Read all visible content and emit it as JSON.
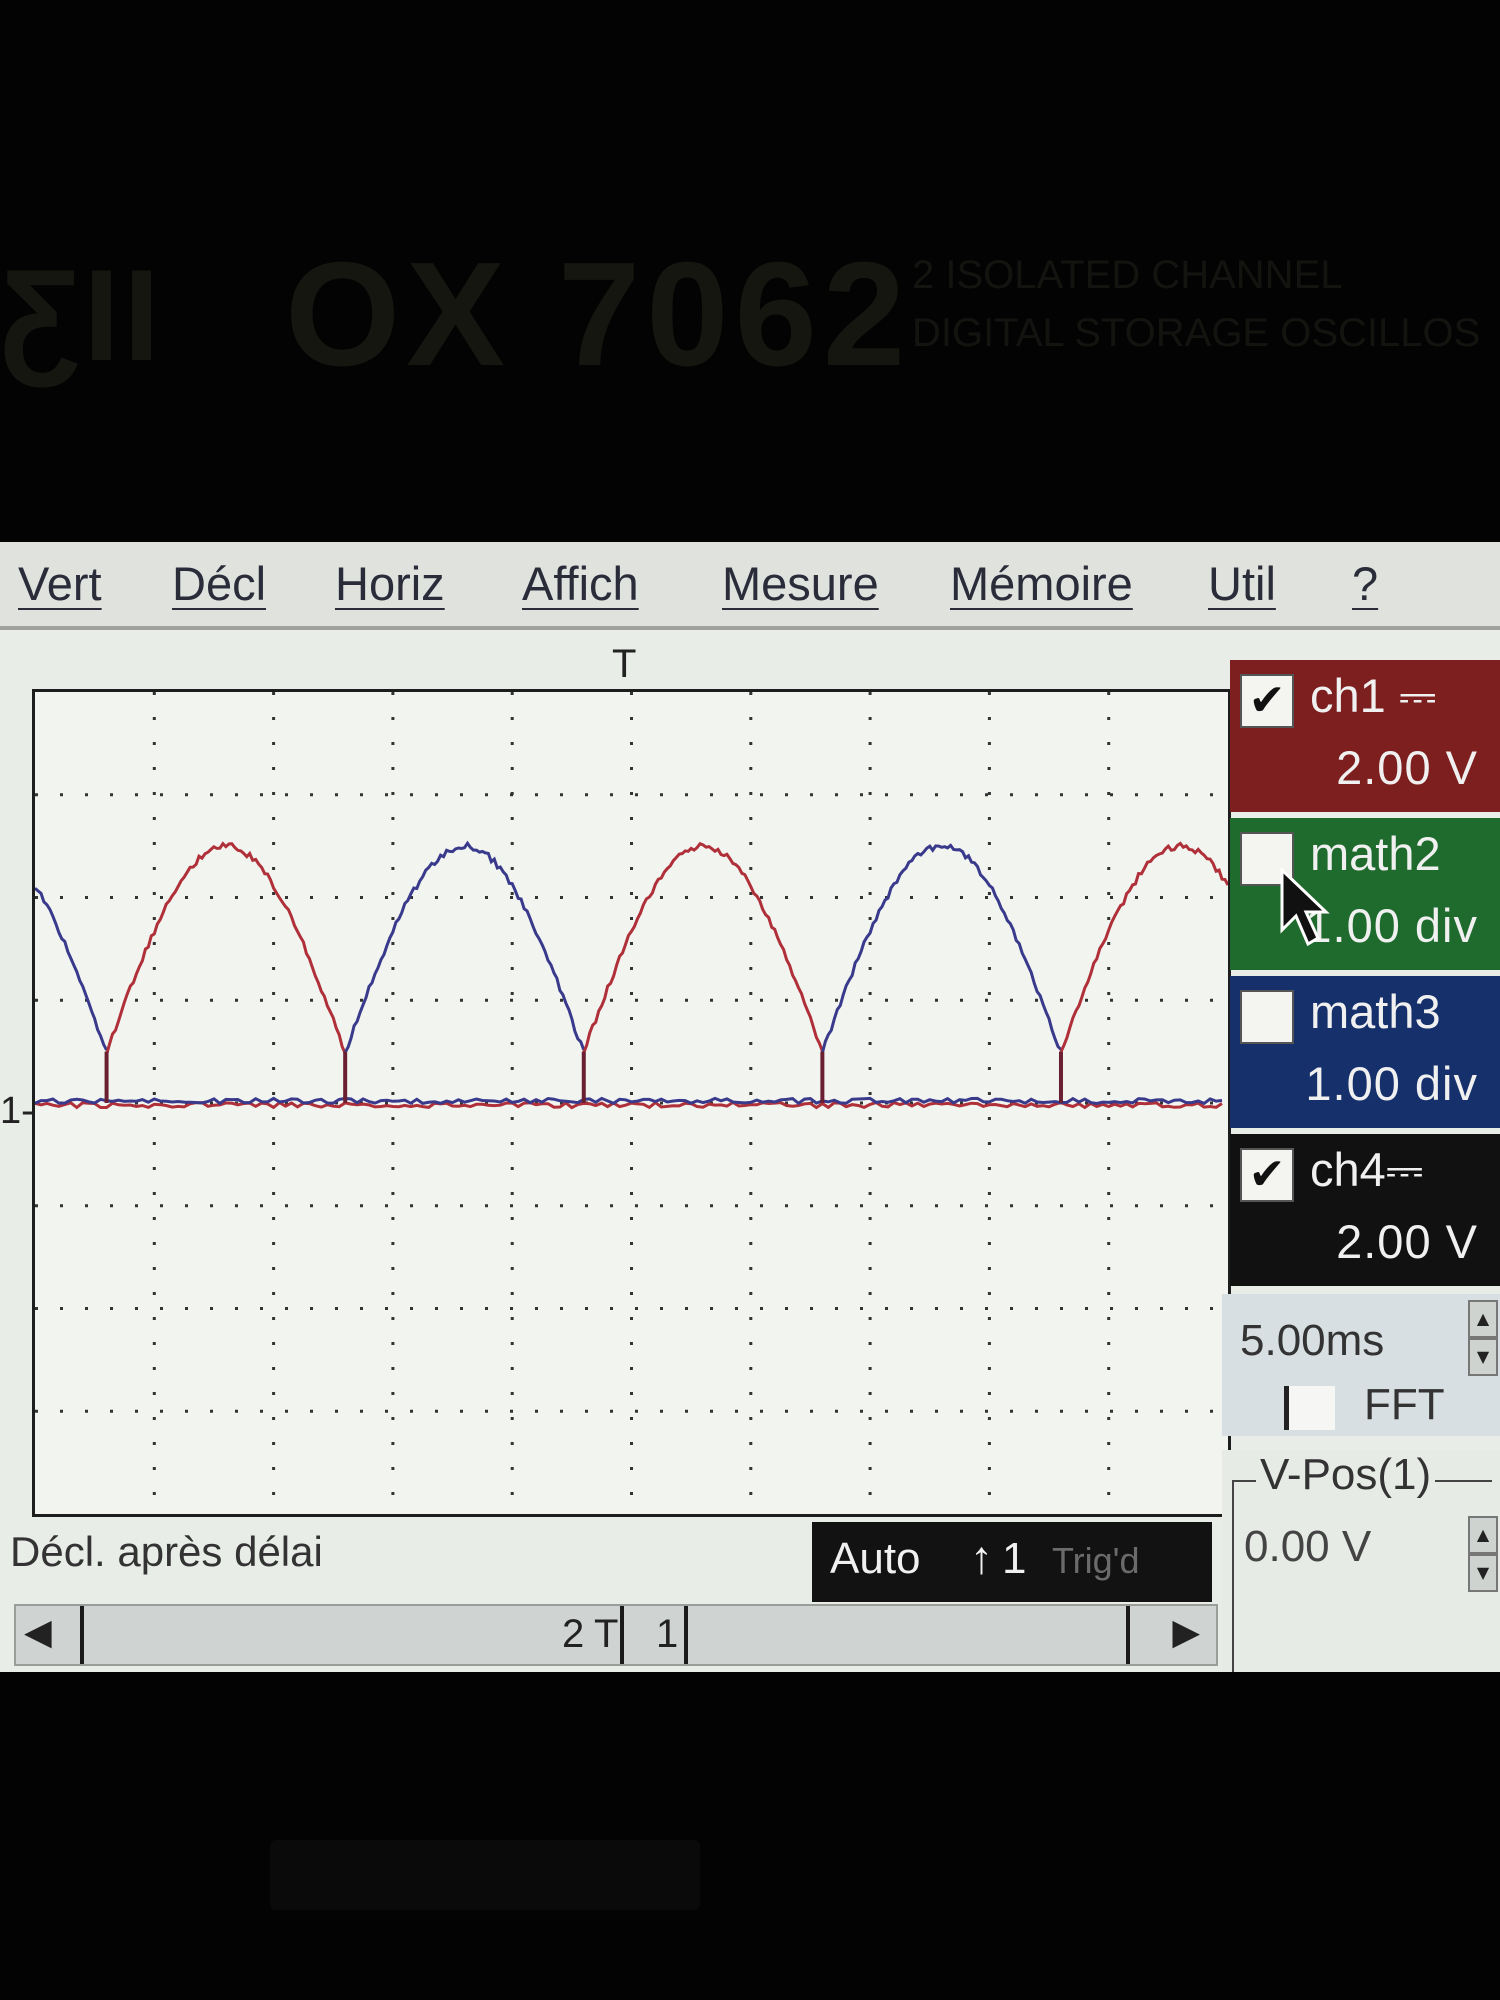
{
  "bezel": {
    "brand_left": "ƸII",
    "model": "OX 7062",
    "description": "2 ISOLATED CHANNEL\nDIGITAL STORAGE OSCILLOS"
  },
  "menu": {
    "items": [
      "Vert",
      "Décl",
      "Horiz",
      "Affich",
      "Mesure",
      "Mémoire",
      "Util",
      "?"
    ]
  },
  "plot": {
    "trigger_marker": "T",
    "ground_marker": "1-",
    "grid": {
      "divisions_x": 10,
      "divisions_y": 8
    }
  },
  "channels": [
    {
      "name": "ch1 ⎓",
      "value": "2.00 V",
      "checked": true,
      "check_glyph": "✔",
      "color": "#7d1f1f"
    },
    {
      "name": "math2",
      "value": "1.00 div",
      "checked": false,
      "check_glyph": "",
      "color": "#1f6b2e"
    },
    {
      "name": "math3",
      "value": "1.00 div",
      "checked": false,
      "check_glyph": "",
      "color": "#16306b"
    },
    {
      "name": "ch4⎓",
      "value": "2.00 V",
      "checked": true,
      "check_glyph": "✔",
      "color": "#111111"
    }
  ],
  "timebase": {
    "value": "5.00ms",
    "fft_label": "FFT"
  },
  "vpos": {
    "label": "V-Pos(1)",
    "value": "0.00 V"
  },
  "status": {
    "text": "Décl. après délai",
    "trigger": {
      "mode": "Auto",
      "edge_icon": "rising-edge-icon",
      "edge_glyph": "↑",
      "source": "1",
      "state": "Trig'd"
    }
  },
  "scrollbar": {
    "marker_2": "2",
    "marker_t": "T",
    "marker_1": "1"
  },
  "chart_data": {
    "type": "line",
    "title": "",
    "xlabel": "",
    "ylabel": "",
    "x_unit_per_div": "5.00ms",
    "y_unit_per_div": "2.00 V",
    "xlim": [
      0,
      10
    ],
    "ylim": [
      -4,
      4
    ],
    "grid": true,
    "series": [
      {
        "name": "ch1",
        "color": "#b0303a",
        "description": "half-wave rectified sine, drops to 0 at each segment boundary",
        "segment_boundaries_div": [
          0.6,
          2.6,
          4.6,
          6.6,
          8.6
        ],
        "peak_div": 2.5,
        "baseline_div": 0.0
      },
      {
        "name": "ch4",
        "color": "#3a3a8c",
        "description": "half-wave rectified sine alternating segments with ch1",
        "segment_boundaries_div": [
          0.6,
          2.6,
          4.6,
          6.6,
          8.6
        ],
        "peak_div": 2.5,
        "baseline_div": 0.0
      }
    ]
  }
}
